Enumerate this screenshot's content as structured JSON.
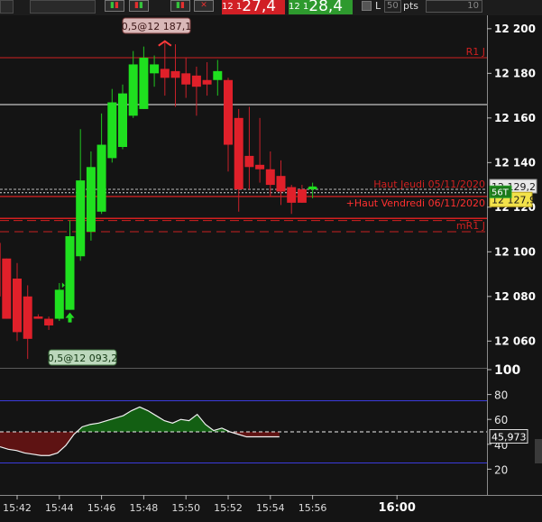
{
  "toolbar": {
    "bid": {
      "prefix": "12 1",
      "main": "27,4",
      "color": "#d11f25"
    },
    "ask": {
      "prefix": "12 1",
      "main": "28,4",
      "color": "#2e9a2e"
    },
    "l_label": "L",
    "pts_value": "50",
    "pts_label": "pts",
    "right_field": "10"
  },
  "price_axis": {
    "labels": [
      "12 200",
      "12 180",
      "12 160",
      "12 140",
      "12 120",
      "12 100",
      "12 080",
      "12 060"
    ],
    "last_price_tag": "12 129,2",
    "current_price_tag": "12 127,9",
    "volume_tag": "56T"
  },
  "lines": {
    "r1": {
      "label": "R1 J",
      "color": "#d02020"
    },
    "mr1": {
      "label": "mR1 J",
      "color": "#d02020"
    },
    "haut_jeudi": {
      "label": "Haut Jeudi 05/11/2020",
      "color": "#d02020"
    },
    "haut_vendredi": {
      "label": "+Haut Vendredi 06/11/2020",
      "color": "#ff3030"
    }
  },
  "callouts": {
    "high": "0,5@12 187,1",
    "low": "0,5@12 093,2"
  },
  "indicator": {
    "axis_labels": [
      "100",
      "80",
      "60",
      "40",
      "20"
    ],
    "value_tag": "45,973"
  },
  "time_axis": {
    "labels": [
      "15:42",
      "15:44",
      "15:46",
      "15:48",
      "15:50",
      "15:52",
      "15:54",
      "15:56",
      "16:00"
    ]
  },
  "chart_data": {
    "type": "candlestick",
    "unit_minutes": 0.5,
    "ohlc": [
      {
        "t": "15:41:00",
        "o": 12104,
        "h": 12104,
        "l": 12082,
        "c": 12080
      },
      {
        "t": "15:41:30",
        "o": 12097,
        "h": 12097,
        "l": 12070,
        "c": 12070
      },
      {
        "t": "15:42:00",
        "o": 12088,
        "h": 12095,
        "l": 12060,
        "c": 12064
      },
      {
        "t": "15:42:30",
        "o": 12080,
        "h": 12085,
        "l": 12052,
        "c": 12061
      },
      {
        "t": "15:43:00",
        "o": 12071,
        "h": 12072,
        "l": 12070,
        "c": 12070
      },
      {
        "t": "15:43:30",
        "o": 12070,
        "h": 12071,
        "l": 12065,
        "c": 12067
      },
      {
        "t": "15:44:00",
        "o": 12070,
        "h": 12086,
        "l": 12069,
        "c": 12083
      },
      {
        "t": "15:44:30",
        "o": 12074,
        "h": 12114,
        "l": 12074,
        "c": 12107
      },
      {
        "t": "15:45:00",
        "o": 12098,
        "h": 12155,
        "l": 12096,
        "c": 12132
      },
      {
        "t": "15:45:30",
        "o": 12109,
        "h": 12145,
        "l": 12105,
        "c": 12138
      },
      {
        "t": "15:46:00",
        "o": 12118,
        "h": 12162,
        "l": 12117,
        "c": 12148
      },
      {
        "t": "15:46:30",
        "o": 12142,
        "h": 12173,
        "l": 12140,
        "c": 12167
      },
      {
        "t": "15:47:00",
        "o": 12147,
        "h": 12175,
        "l": 12146,
        "c": 12171
      },
      {
        "t": "15:47:30",
        "o": 12161,
        "h": 12190,
        "l": 12160,
        "c": 12184
      },
      {
        "t": "15:48:00",
        "o": 12164,
        "h": 12192,
        "l": 12164,
        "c": 12187
      },
      {
        "t": "15:48:30",
        "o": 12180,
        "h": 12188,
        "l": 12174,
        "c": 12184
      },
      {
        "t": "15:49:00",
        "o": 12182,
        "h": 12194,
        "l": 12170,
        "c": 12178
      },
      {
        "t": "15:49:30",
        "o": 12181,
        "h": 12193,
        "l": 12165,
        "c": 12178
      },
      {
        "t": "15:50:00",
        "o": 12180,
        "h": 12187,
        "l": 12169,
        "c": 12175
      },
      {
        "t": "15:50:30",
        "o": 12179,
        "h": 12183,
        "l": 12161,
        "c": 12174
      },
      {
        "t": "15:51:00",
        "o": 12177,
        "h": 12185,
        "l": 12170,
        "c": 12175
      },
      {
        "t": "15:51:30",
        "o": 12177,
        "h": 12186,
        "l": 12170,
        "c": 12181
      },
      {
        "t": "15:52:00",
        "o": 12177,
        "h": 12178,
        "l": 12136,
        "c": 12148
      },
      {
        "t": "15:52:30",
        "o": 12160,
        "h": 12164,
        "l": 12118,
        "c": 12128
      },
      {
        "t": "15:53:00",
        "o": 12143,
        "h": 12165,
        "l": 12128,
        "c": 12138
      },
      {
        "t": "15:53:30",
        "o": 12139,
        "h": 12160,
        "l": 12131,
        "c": 12137
      },
      {
        "t": "15:54:00",
        "o": 12137,
        "h": 12145,
        "l": 12125,
        "c": 12130
      },
      {
        "t": "15:54:30",
        "o": 12134,
        "h": 12141,
        "l": 12121,
        "c": 12127
      },
      {
        "t": "15:55:00",
        "o": 12129,
        "h": 12130,
        "l": 12117,
        "c": 12122
      },
      {
        "t": "15:55:30",
        "o": 12128,
        "h": 12130,
        "l": 12122,
        "c": 12122
      },
      {
        "t": "15:56:00",
        "o": 12128,
        "h": 12131,
        "l": 12124,
        "c": 12129
      }
    ],
    "price_range": [
      12048,
      12206
    ],
    "horizontal_levels": {
      "r1": 12187,
      "white": 12166,
      "haut_jeudi": 12128,
      "dotted_upper": 12126.5,
      "haut_vendredi": 12124.8,
      "red_solid": 12115,
      "red_dashed": 12114,
      "mr1": 12109
    },
    "oscillator": {
      "range": [
        0,
        100
      ],
      "upper": 75,
      "lower": 25,
      "mid": 50,
      "values": [
        38,
        36,
        35,
        33,
        32,
        31,
        31,
        33,
        39,
        48,
        54,
        56,
        57,
        59,
        61,
        63,
        67,
        70,
        67,
        63,
        59,
        57,
        60,
        59,
        64,
        56,
        51,
        53,
        50,
        48,
        46,
        46,
        46,
        46,
        46
      ]
    }
  }
}
